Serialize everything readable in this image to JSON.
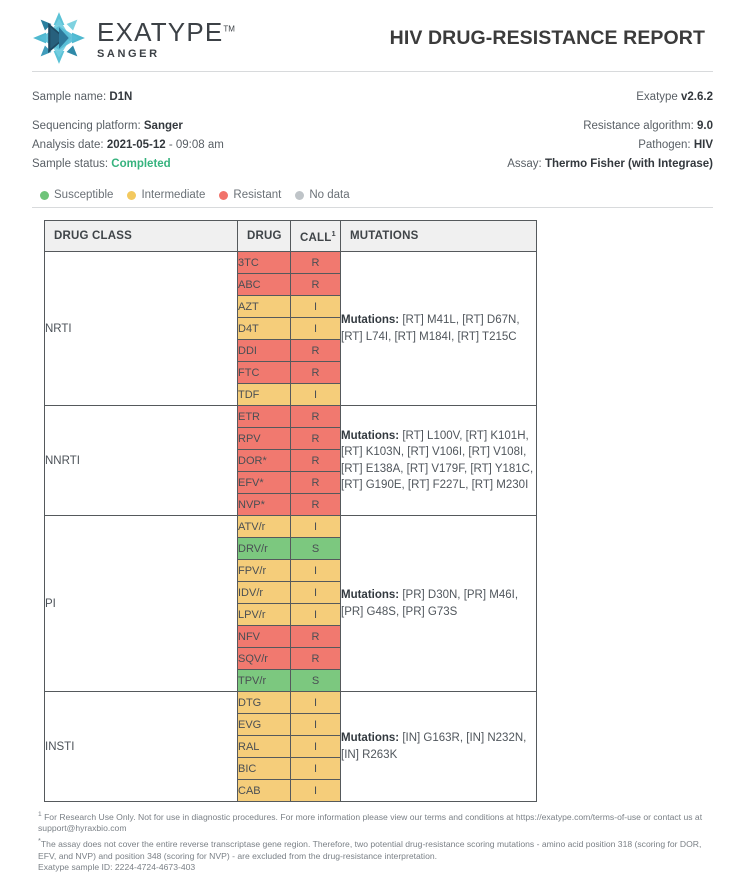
{
  "brand": {
    "name": "EXATYPE",
    "trademark": "TM",
    "sub": "SANGER",
    "logo_icon": "exatype-starburst-logo"
  },
  "header": {
    "title": "HIV DRUG-RESISTANCE REPORT"
  },
  "meta": {
    "sample_name_label": "Sample name:",
    "sample_name_value": "D1N",
    "version_label": "Exatype",
    "version_value": "v2.6.2",
    "platform_label": "Sequencing platform:",
    "platform_value": "Sanger",
    "analysis_date_label": "Analysis date:",
    "analysis_date_value": "2021-05-12",
    "analysis_time_value": "- 09:08 am",
    "status_label": "Sample status:",
    "status_value": "Completed",
    "algorithm_label": "Resistance algorithm:",
    "algorithm_value": "9.0",
    "pathogen_label": "Pathogen:",
    "pathogen_value": "HIV",
    "assay_label": "Assay:",
    "assay_value": "Thermo Fisher (with Integrase)"
  },
  "legend": {
    "items": [
      {
        "label": "Susceptible",
        "color": "#6fc47a"
      },
      {
        "label": "Intermediate",
        "color": "#f3c95f"
      },
      {
        "label": "Resistant",
        "color": "#f1736b"
      },
      {
        "label": "No data",
        "color": "#bfc4c8"
      }
    ]
  },
  "table": {
    "headers": {
      "drug_class": "DRUG CLASS",
      "drug": "DRUG",
      "call": "CALL",
      "call_sup": "1",
      "mutations": "MUTATIONS"
    },
    "sections": [
      {
        "drug_class": "NRTI",
        "mutations_label": "Mutations:",
        "mutations_text": "[RT] M41L, [RT] D67N, [RT] L74I, [RT] M184I, [RT] T215C",
        "drugs": [
          {
            "name": "3TC",
            "call": "R"
          },
          {
            "name": "ABC",
            "call": "R"
          },
          {
            "name": "AZT",
            "call": "I"
          },
          {
            "name": "D4T",
            "call": "I"
          },
          {
            "name": "DDI",
            "call": "R"
          },
          {
            "name": "FTC",
            "call": "R"
          },
          {
            "name": "TDF",
            "call": "I"
          }
        ]
      },
      {
        "drug_class": "NNRTI",
        "mutations_label": "Mutations:",
        "mutations_text": "[RT] L100V, [RT] K101H, [RT] K103N, [RT] V106I, [RT] V108I, [RT] E138A, [RT] V179F, [RT] Y181C, [RT] G190E, [RT] F227L, [RT] M230I",
        "drugs": [
          {
            "name": "ETR",
            "call": "R"
          },
          {
            "name": "RPV",
            "call": "R"
          },
          {
            "name": "DOR*",
            "call": "R"
          },
          {
            "name": "EFV*",
            "call": "R"
          },
          {
            "name": "NVP*",
            "call": "R"
          }
        ]
      },
      {
        "drug_class": "PI",
        "mutations_label": "Mutations:",
        "mutations_text": "[PR] D30N, [PR] M46I, [PR] G48S, [PR] G73S",
        "drugs": [
          {
            "name": "ATV/r",
            "call": "I"
          },
          {
            "name": "DRV/r",
            "call": "S"
          },
          {
            "name": "FPV/r",
            "call": "I"
          },
          {
            "name": "IDV/r",
            "call": "I"
          },
          {
            "name": "LPV/r",
            "call": "I"
          },
          {
            "name": "NFV",
            "call": "R"
          },
          {
            "name": "SQV/r",
            "call": "R"
          },
          {
            "name": "TPV/r",
            "call": "S"
          }
        ]
      },
      {
        "drug_class": "INSTI",
        "mutations_label": "Mutations:",
        "mutations_text": "[IN] G163R, [IN] N232N, [IN] R263K",
        "drugs": [
          {
            "name": "DTG",
            "call": "I"
          },
          {
            "name": "EVG",
            "call": "I"
          },
          {
            "name": "RAL",
            "call": "I"
          },
          {
            "name": "BIC",
            "call": "I"
          },
          {
            "name": "CAB",
            "call": "I"
          }
        ]
      }
    ]
  },
  "footer": {
    "note1_sup": "1",
    "note1": "For Research Use Only. Not for use in diagnostic procedures. For more information please view our terms and conditions at https://exatype.com/terms-of-use or contact us at support@hyraxbio.com",
    "note2_star": "*",
    "note2": "The assay does not cover the entire reverse transcriptase gene region. Therefore, two potential drug-resistance scoring mutations - amino acid position 318 (scoring for DOR, EFV, and NVP) and position 348 (scoring for NVP) - are excluded from the drug-resistance interpretation.",
    "sample_id": "Exatype sample ID: 2224-4724-4673-403"
  }
}
